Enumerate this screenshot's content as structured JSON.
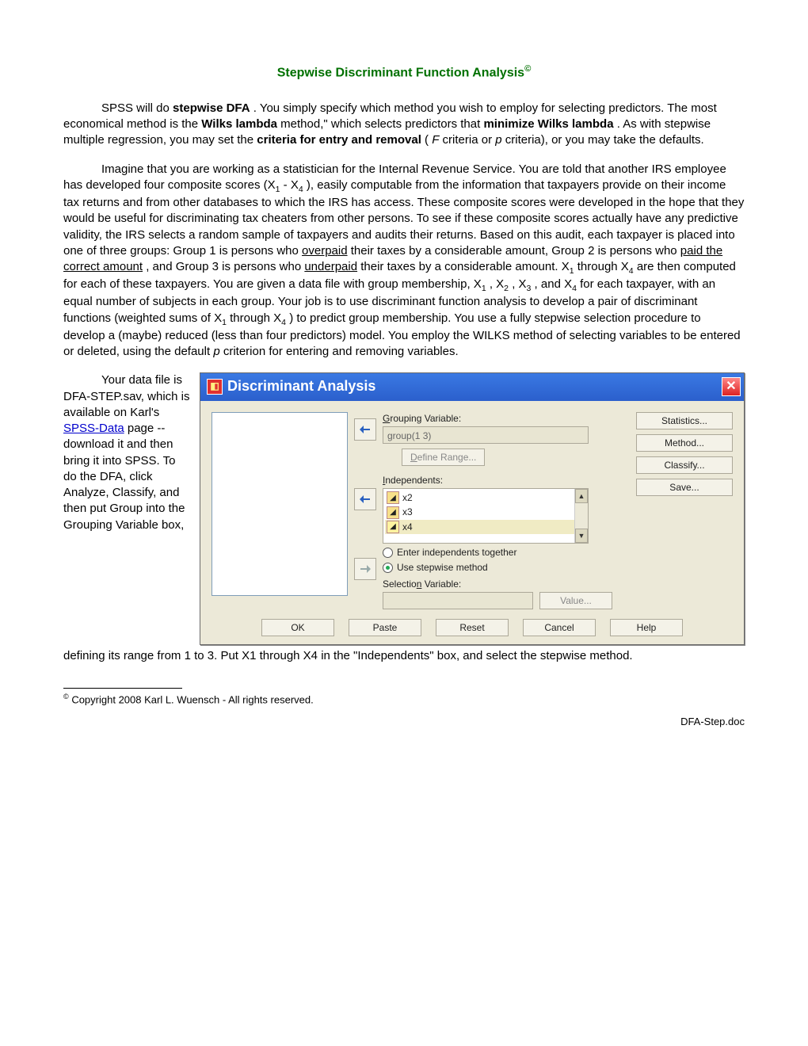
{
  "title": "Stepwise Discriminant Function Analysis",
  "title_mark": "©",
  "p1_lead": "SPSS will do ",
  "p1_bold1": "stepwise DFA",
  "p1_a": ".  You simply specify which method you wish to employ for selecting predictors.  The most economical method is the ",
  "p1_bold2": "Wilks lambda",
  "p1_b": " method,\" which selects predictors that ",
  "p1_bold3": "minimize Wilks lambda",
  "p1_c": ".  As with stepwise multiple regression, you may set the ",
  "p1_bold4": "criteria for  entry and removal",
  "p1_d": " (",
  "p1_if": "F",
  "p1_e": " criteria or ",
  "p1_ip": "p",
  "p1_f": " criteria), or you may take the defaults.",
  "p2_a": "Imagine that you are working as a statistician for the Internal Revenue Service.  You are told that another IRS employee has developed four composite scores (X",
  "p2_sub1": "1",
  "p2_b": " - X",
  "p2_sub4": "4",
  "p2_c": "), easily computable from the information that taxpayers provide on their income tax returns and from other databases to which the IRS has access.  These composite scores were developed in the hope that they would be useful for discriminating tax cheaters from other persons.  To see if these composite scores actually have any predictive validity, the IRS selects a random sample of taxpayers and audits their returns.  Based on this audit, each taxpayer is placed into one of three groups: Group 1 is persons who ",
  "p2_u1": "overpaid",
  "p2_d": " their taxes by a considerable amount, Group 2 is persons who ",
  "p2_u2": "paid the correct amount",
  "p2_e": ", and Group 3 is persons who ",
  "p2_u3": "underpaid",
  "p2_f": " their taxes by a considerable amount.  X",
  "p2_g": " through X",
  "p2_h": " are then computed for each of these taxpayers.  You are given a data file with group membership, X",
  "p2_i": ", X",
  "p2_sub2": "2",
  "p2_j": ", X",
  "p2_sub3": "3",
  "p2_k": ", and X",
  "p2_l": " for each taxpayer, with an equal number of subjects in each group.  Your job is to use discriminant function analysis to develop a pair of discriminant functions (weighted sums of X",
  "p2_m": " through X",
  "p2_n": ") to predict group membership.  You use a fully stepwise selection procedure to develop a (maybe) reduced (less than four predictors) model.  You employ the WILKS method of selecting variables to be entered or deleted, using the default ",
  "p2_o": " criterion for entering and removing variables.",
  "side_a": "Your data file is DFA-STEP.sav, which is available on Karl's ",
  "side_link": "SPSS-Data",
  "side_b": " page -- download it and then bring it into SPSS.  To do the DFA, click Analyze, Classify, and then put Group into the Grouping Variable box,",
  "p3": "defining its range from 1 to 3.  Put X1 through X4 in the \"Independents\" box, and select the stepwise method.",
  "dialog": {
    "title": "Discriminant Analysis",
    "grouping_label": "Grouping Variable:",
    "grouping_value": "group(1 3)",
    "define_range": "Define Range...",
    "independents_label": "Independents:",
    "vars": {
      "x2": "x2",
      "x3": "x3",
      "x4": "x4"
    },
    "radio_enter": "Enter independents together",
    "radio_step": "Use stepwise method",
    "selection_label": "Selection Variable:",
    "value_btn": "Value...",
    "right": {
      "stats": "Statistics...",
      "method": "Method...",
      "classify": "Classify...",
      "save": "Save..."
    },
    "bottom": {
      "ok": "OK",
      "paste": "Paste",
      "reset": "Reset",
      "cancel": "Cancel",
      "help": "Help"
    }
  },
  "footnote_mark": "©",
  "footnote": " Copyright 2008 Karl L. Wuensch - All rights reserved.",
  "footer_right": "DFA-Step.doc"
}
